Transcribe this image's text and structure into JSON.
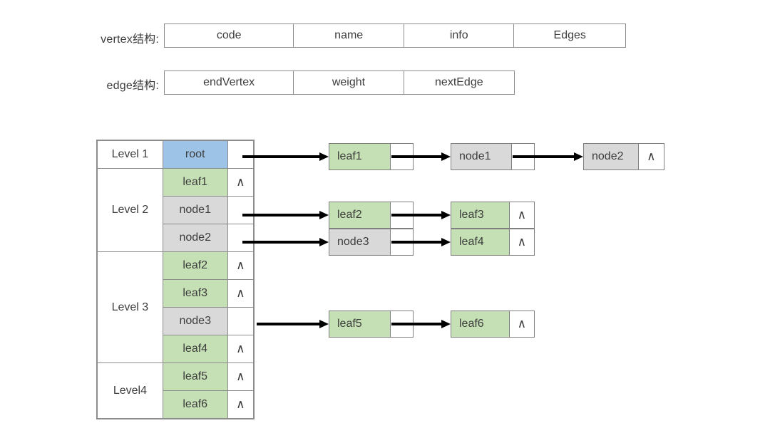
{
  "structs": [
    {
      "label": "vertex结构:",
      "fields": [
        "code",
        "name",
        "info",
        "Edges"
      ]
    },
    {
      "label": "edge结构:",
      "fields": [
        "endVertex",
        "weight",
        "nextEdge"
      ]
    }
  ],
  "level_table": {
    "rows": [
      {
        "level": "Level 1",
        "name": "root",
        "color": "blue",
        "pointer": ""
      },
      {
        "level": "Level 2",
        "name": "leaf1",
        "color": "green",
        "pointer": "∧"
      },
      {
        "level": "",
        "name": "node1",
        "color": "gray",
        "pointer": ""
      },
      {
        "level": "",
        "name": "node2",
        "color": "gray",
        "pointer": ""
      },
      {
        "level": "Level 3",
        "name": "leaf2",
        "color": "green",
        "pointer": "∧"
      },
      {
        "level": "",
        "name": "leaf3",
        "color": "green",
        "pointer": "∧"
      },
      {
        "level": "",
        "name": "node3",
        "color": "gray",
        "pointer": ""
      },
      {
        "level": "",
        "name": "leaf4",
        "color": "green",
        "pointer": "∧"
      },
      {
        "level": "Level4",
        "name": "leaf5",
        "color": "green",
        "pointer": "∧"
      },
      {
        "level": "",
        "name": "leaf6",
        "color": "green",
        "pointer": "∧"
      }
    ]
  },
  "chains": [
    {
      "source_row": "root",
      "nodes": [
        {
          "value": "leaf1",
          "color": "green",
          "pointer": ""
        },
        {
          "value": "node1",
          "color": "gray",
          "pointer": ""
        },
        {
          "value": "node2",
          "color": "gray",
          "pointer": "∧"
        }
      ]
    },
    {
      "source_row": "node1",
      "nodes": [
        {
          "value": "leaf2",
          "color": "green",
          "pointer": ""
        },
        {
          "value": "leaf3",
          "color": "green",
          "pointer": "∧"
        }
      ]
    },
    {
      "source_row": "node2",
      "nodes": [
        {
          "value": "node3",
          "color": "gray",
          "pointer": ""
        },
        {
          "value": "leaf4",
          "color": "green",
          "pointer": "∧"
        }
      ]
    },
    {
      "source_row": "node3",
      "nodes": [
        {
          "value": "leaf5",
          "color": "green",
          "pointer": ""
        },
        {
          "value": "leaf6",
          "color": "green",
          "pointer": "∧"
        }
      ]
    }
  ],
  "colors": {
    "root_blue": "#9dc3e6",
    "leaf_green": "#c5e0b4",
    "node_gray": "#d9d9d9",
    "border": "#8c8c8c",
    "text": "#3d3d3d",
    "arrow": "#000000",
    "background": "#ffffff"
  }
}
